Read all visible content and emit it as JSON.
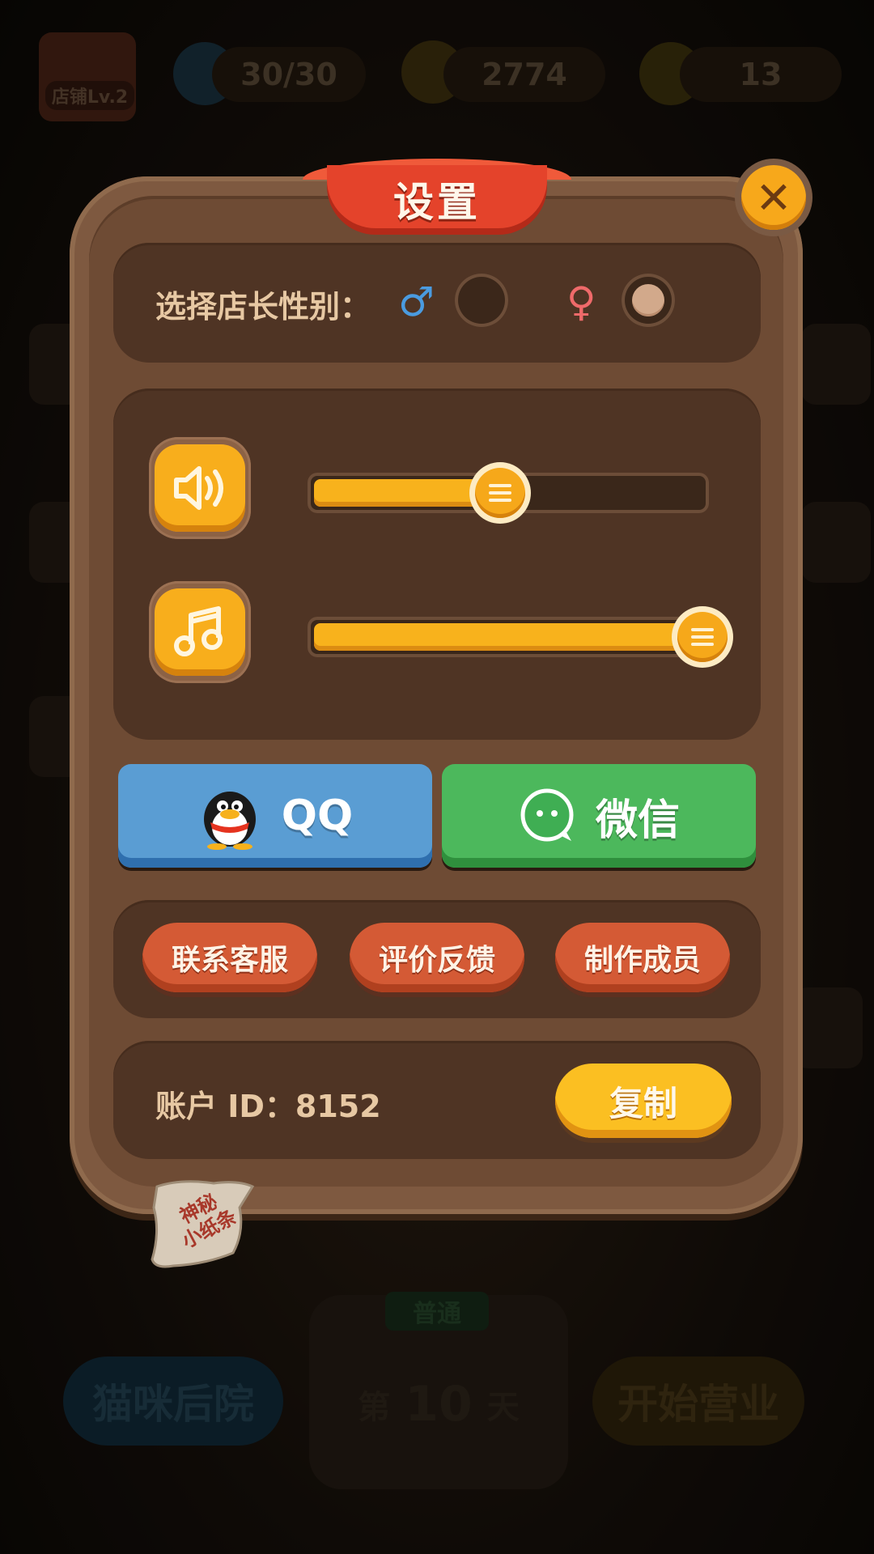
{
  "background": {
    "shop_level": "店铺Lv.2",
    "stamina": "30/30",
    "coins": "2774",
    "stars": "13",
    "bottom_left": "猫咪后院",
    "bottom_center_tag": "普通",
    "bottom_center_day_prefix": "第",
    "bottom_center_day": "10",
    "bottom_center_day_suffix": "天",
    "bottom_right": "开始营业"
  },
  "dialog": {
    "title": "设置",
    "close_icon": "close-icon",
    "gender": {
      "label": "选择店长性别：",
      "male_symbol": "♂",
      "female_symbol": "♀",
      "male_selected": false,
      "female_selected": true
    },
    "sliders": [
      {
        "name": "sound-effects",
        "icon": "speaker-icon",
        "level": 0.48
      },
      {
        "name": "music",
        "icon": "music-note-icon",
        "level": 1.0
      }
    ],
    "share": {
      "qq_label": "QQ",
      "wechat_label": "微信"
    },
    "links": [
      "联系客服",
      "评价反馈",
      "制作成员"
    ],
    "account": {
      "label": "账户 ID：8152",
      "copy_label": "复制"
    },
    "note_text": "神秘\n小纸条"
  },
  "colors": {
    "dialog_bg": "#6e4b34",
    "panel_bg": "#4f3424",
    "accent_orange": "#f8ae1c",
    "ribbon_red": "#e4432b",
    "qq_blue": "#5a9dd3",
    "wechat_green": "#4cb85c"
  }
}
